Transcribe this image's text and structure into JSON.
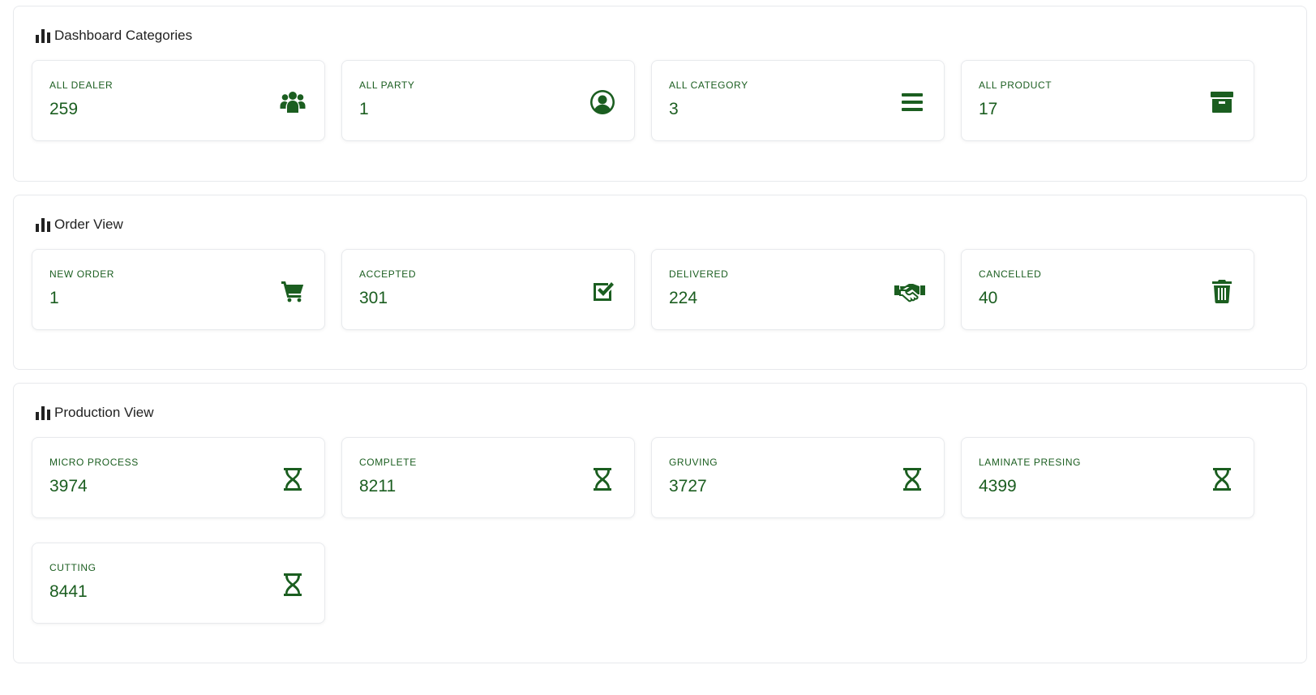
{
  "accent_color": "#1b5e20",
  "sections": [
    {
      "title": "Dashboard Categories",
      "cards": [
        {
          "label": "ALL DEALER",
          "value": "259",
          "icon": "users-icon"
        },
        {
          "label": "ALL PARTY",
          "value": "1",
          "icon": "user-circle-icon"
        },
        {
          "label": "ALL CATEGORY",
          "value": "3",
          "icon": "list-icon"
        },
        {
          "label": "ALL PRODUCT",
          "value": "17",
          "icon": "archive-box-icon"
        }
      ]
    },
    {
      "title": "Order View",
      "cards": [
        {
          "label": "NEW ORDER",
          "value": "1",
          "icon": "cart-icon"
        },
        {
          "label": "ACCEPTED",
          "value": "301",
          "icon": "checkbox-icon"
        },
        {
          "label": "DELIVERED",
          "value": "224",
          "icon": "handshake-icon"
        },
        {
          "label": "CANCELLED",
          "value": "40",
          "icon": "trash-icon"
        }
      ]
    },
    {
      "title": "Production View",
      "cards": [
        {
          "label": "MICRO PROCESS",
          "value": "3974",
          "icon": "hourglass-icon"
        },
        {
          "label": "COMPLETE",
          "value": "8211",
          "icon": "hourglass-icon"
        },
        {
          "label": "GRUVING",
          "value": "3727",
          "icon": "hourglass-icon"
        },
        {
          "label": "LAMINATE PRESING",
          "value": "4399",
          "icon": "hourglass-icon"
        },
        {
          "label": "CUTTING",
          "value": "8441",
          "icon": "hourglass-icon"
        }
      ]
    }
  ]
}
